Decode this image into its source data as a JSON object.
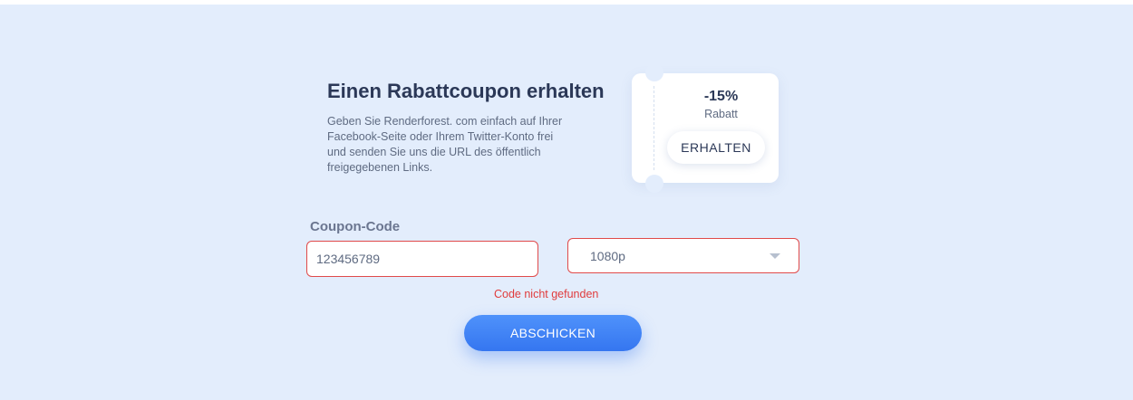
{
  "coupon_section": {
    "title": "Einen Rabattcoupon erhalten",
    "description": "Geben Sie Renderforest. com einfach auf Ihrer Facebook-Seite oder Ihrem Twitter-Konto frei und senden Sie uns die URL des öffentlich freigegebenen Links."
  },
  "ticket": {
    "discount": "-15%",
    "discount_label": "Rabatt",
    "button_label": "ERHALTEN"
  },
  "form": {
    "code_label": "Coupon-Code",
    "code_value": "123456789",
    "resolution_selected": "1080p",
    "error_message": "Code nicht gefunden",
    "submit_label": "ABSCHICKEN"
  },
  "colors": {
    "background": "#e3edfc",
    "accent": "#3576f0",
    "error": "#e03c3c",
    "heading": "#2b3857"
  }
}
